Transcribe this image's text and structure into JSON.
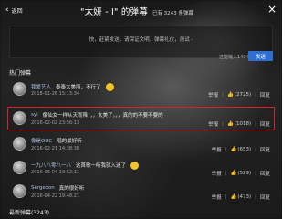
{
  "header": {
    "back_label": "返回",
    "title": "\"太妍 - I\" 的弹幕",
    "count_text": "已有 3243 条弹幕"
  },
  "compose": {
    "placeholder": "快，赶紧发送，请保证文明，弹幕礼仪，测试 -",
    "remaining": "还能输入140个字",
    "send_label": "发送"
  },
  "sections": {
    "hot_label": "热门弹幕",
    "new_label": "最新弹幕(3243)"
  },
  "comments": [
    {
      "user": "我爱艺人",
      "text": "泰泰大美丽，不行了",
      "has_emoji": true,
      "date": "2018-01-26 15:13:34",
      "report": "举报",
      "likes": "(2725)",
      "reply": "回复"
    },
    {
      "user": "syi",
      "text": "像仙女一样从天而降，，，太美了，，，真的的不要不要的",
      "has_emoji": false,
      "date": "2016-02-02 23:56:13",
      "report": "举报",
      "likes": "(1018)",
      "reply": "回复"
    },
    {
      "user": "像是OUC",
      "text": "唱的最好听",
      "has_emoji": false,
      "date": "2016-02-21 14:38:38",
      "report": "举报",
      "likes": "(653)",
      "reply": "回复"
    },
    {
      "user": "一九八八零八一八",
      "text": "这首歌一听我就入迷了",
      "has_emoji": true,
      "date": "2016-05-04 19:52:11",
      "report": "举报",
      "likes": "(529)",
      "reply": "回复"
    },
    {
      "user": "Sergexon",
      "text": "真的很好听",
      "has_emoji": false,
      "date": "2016-04-22 19:48:21",
      "report": "举报",
      "likes": "(473)",
      "reply": "回复"
    }
  ],
  "icons": {
    "back": "chevron-left-icon",
    "close": "close-icon",
    "like": "thumbs-up-icon"
  },
  "colors": {
    "send_button": "#2e6fd1",
    "highlight_border": "#d32525"
  }
}
